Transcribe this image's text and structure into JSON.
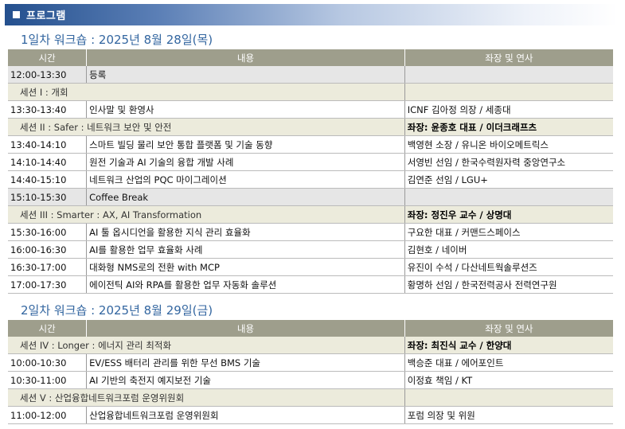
{
  "section_title": "프로그램",
  "columns": {
    "time": "시간",
    "content": "내용",
    "chair": "좌장 및 연사"
  },
  "day1": {
    "title": "1일차 워크숍 : 2025년 8월 28일(목)",
    "rows": [
      {
        "type": "reg",
        "time": "12:00-13:30",
        "content": "등록",
        "speaker": ""
      },
      {
        "type": "sess",
        "label": "세션 I : 개회",
        "chair": ""
      },
      {
        "type": "talk",
        "time": "13:30-13:40",
        "content": " 인사말 및 환영사",
        "speaker": "ICNF 김아정 의장 / 세종대"
      },
      {
        "type": "sess",
        "label": "세션 II :  Safer : 네트워크 보안 및 안전",
        "chair": "좌장: 윤종호 대표 / 이더크래프츠"
      },
      {
        "type": "talk",
        "time": "13:40-14:10",
        "content": "스마트 빌딩 물리 보안 통합 플랫폼 및 기술 동향",
        "speaker": "백영현 소장 / 유니온 바이오메트릭스"
      },
      {
        "type": "talk",
        "time": "14:10-14:40",
        "content": "원전 기술과 AI 기술의 융합 개발 사례",
        "speaker": "서영빈 선임 / 한국수력원자력 중앙연구소"
      },
      {
        "type": "talk",
        "time": "14:40-15:10",
        "content": "네트워크 산업의 PQC 마이그레이션",
        "speaker": "김연준 선임 / LGU+"
      },
      {
        "type": "brk",
        "time": "15:10-15:30",
        "content": " Coffee Break",
        "speaker": ""
      },
      {
        "type": "sess",
        "label": "세션 III : Smarter : AX, AI Transformation",
        "chair": "좌장: 정진우 교수 / 상명대"
      },
      {
        "type": "talk",
        "time": "15:30-16:00",
        "content": "AI 툴 옵시디언을 활용한 지식 관리 효율화",
        "speaker": "구요한 대표 / 커맨드스페이스"
      },
      {
        "type": "talk",
        "time": "16:00-16:30",
        "content": "AI를 활용한 업무 효율화 사례",
        "speaker": "김현호 / 네이버"
      },
      {
        "type": "talk",
        "time": "16:30-17:00",
        "content": "대화형 NMS로의 전환 with MCP",
        "speaker": "유진이 수석 / 다산네트웍솔루션즈"
      },
      {
        "type": "talk",
        "time": "17:00-17:30",
        "content": "에이전틱 AI와 RPA를 활용한 업무 자동화 솔루션",
        "speaker": "황명하 선임 / 한국전력공사 전력연구원"
      }
    ]
  },
  "day2": {
    "title": "2일차 워크숍 : 2025년 8월 29일(금)",
    "rows": [
      {
        "type": "sess",
        "label": "세션 IV : Longer : 에너지 관리 최적화",
        "chair": "좌장: 최진식 교수 / 한양대"
      },
      {
        "type": "talk",
        "time": "10:00-10:30",
        "content": "EV/ESS 배터리 관리를 위한 무선 BMS 기술",
        "speaker": "백승준 대표 / 에어포인트"
      },
      {
        "type": "talk",
        "time": "10:30-11:00",
        "content": "AI 기반의 축전지 예지보전 기술",
        "speaker": "이정효 책임 / KT"
      },
      {
        "type": "sess",
        "label": "세션 V : 산업융합네트워크포럼 운영위원회",
        "chair": ""
      },
      {
        "type": "talk",
        "time": "11:00-12:00",
        "content": " 산업융합네트워크포럼 운영위원회",
        "speaker": "포럼 의장 및 위원"
      }
    ]
  }
}
